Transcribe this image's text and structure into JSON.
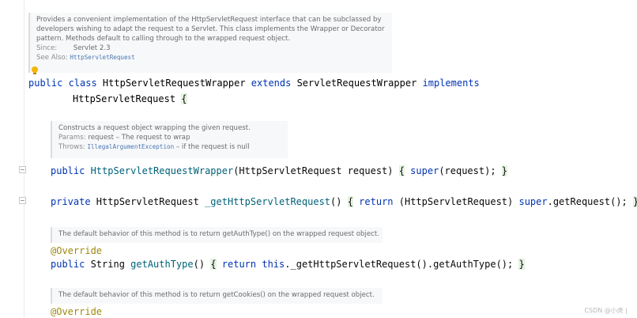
{
  "doc_class": {
    "lines": [
      "Provides a convenient implementation of the HttpServletRequest interface that can be subclassed by",
      "developers wishing to adapt the request to a Servlet. This class implements the Wrapper or Decorator",
      "pattern. Methods default to calling through to the wrapped request object."
    ],
    "since_label": "Since:",
    "since_value": "Servlet 2.3",
    "see_label": "See Also:",
    "see_value": "HttpServletRequest"
  },
  "class_decl": {
    "line1": {
      "kw1": "public class ",
      "name": "HttpServletRequestWrapper",
      "kw2": " extends ",
      "parent": "ServletRequestWrapper",
      "kw3": " implements"
    },
    "line2": {
      "iface": "HttpServletRequest",
      "brace": "{"
    }
  },
  "doc_ctor": {
    "line": "Constructs a request object wrapping the given request.",
    "params_label": "Params:",
    "params_value": "request – The request to wrap",
    "throws_label": "Throws:",
    "throws_value": "IllegalArgumentException",
    "throws_rest": " – if the request is null"
  },
  "ctor": {
    "kw": "public ",
    "name": "HttpServletRequestWrapper",
    "params": "(HttpServletRequest request) ",
    "open": "{",
    "kw_super": " super",
    "body": "(request); ",
    "close": "}"
  },
  "private_method": {
    "kw": "private ",
    "type": "HttpServletRequest ",
    "name": "_getHttpServletRequest",
    "params": "() ",
    "open": "{",
    "kw_return": " return ",
    "cast": "(HttpServletRequest) ",
    "kw_super": "super",
    "rest": ".getRequest(); ",
    "close": "}"
  },
  "doc_authtype": {
    "line": "The default behavior of this method is to return getAuthType() on the wrapped request object."
  },
  "auth_method": {
    "annotation": "@Override",
    "kw": "public ",
    "type": "String ",
    "name": "getAuthType",
    "params": "() ",
    "open": "{",
    "kw_return": " return ",
    "kw_this": "this",
    "rest": "._getHttpServletRequest().getAuthType(); ",
    "close": "}"
  },
  "doc_cookies": {
    "line": "The default behavior of this method is to return getCookies() on the wrapped request object."
  },
  "cookies_method": {
    "annotation": "@Override"
  },
  "watermark": "CSDN @小虎 |"
}
